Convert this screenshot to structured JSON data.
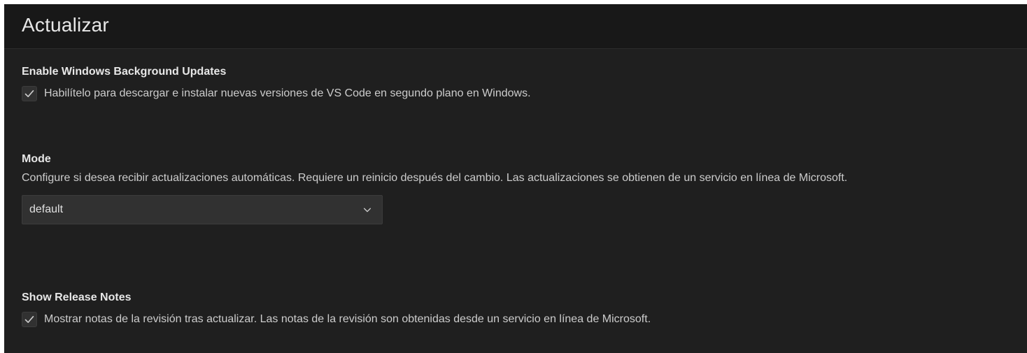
{
  "section": {
    "title": "Actualizar"
  },
  "settings": {
    "background_updates": {
      "title": "Enable Windows Background Updates",
      "description": "Habilítelo para descargar e instalar nuevas versiones de VS Code en segundo plano en Windows.",
      "checked": true,
      "icon": "check-icon"
    },
    "mode": {
      "title": "Mode",
      "description": "Configure si desea recibir actualizaciones automáticas. Requiere un reinicio después del cambio. Las actualizaciones se obtienen de un servicio en línea de Microsoft.",
      "value": "default",
      "icon": "chevron-down-icon"
    },
    "release_notes": {
      "title": "Show Release Notes",
      "description": "Mostrar notas de la revisión tras actualizar. Las notas de la revisión son obtenidas desde un servicio en línea de Microsoft.",
      "checked": true,
      "icon": "check-icon"
    }
  },
  "colors": {
    "background": "#1f1f1f",
    "header_background": "#181818",
    "input_background": "#313131",
    "text": "#cccccc",
    "title_text": "#e7e7e7"
  }
}
